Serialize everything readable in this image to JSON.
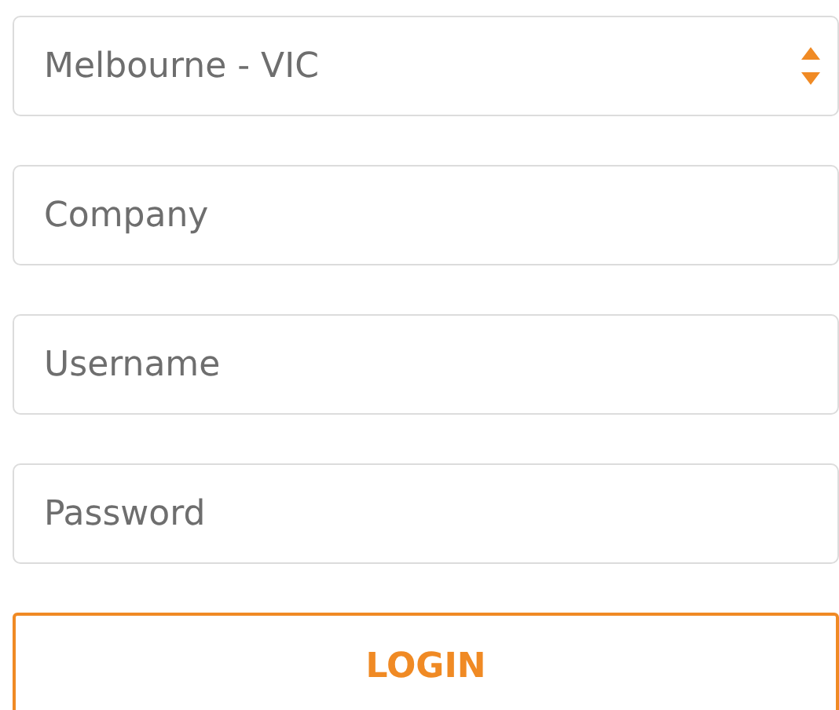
{
  "location_select": {
    "value": "Melbourne - VIC"
  },
  "fields": [
    {
      "placeholder": "Company"
    },
    {
      "placeholder": "Username"
    },
    {
      "placeholder": "Password"
    }
  ],
  "login_button": {
    "label": "LOGIN"
  }
}
